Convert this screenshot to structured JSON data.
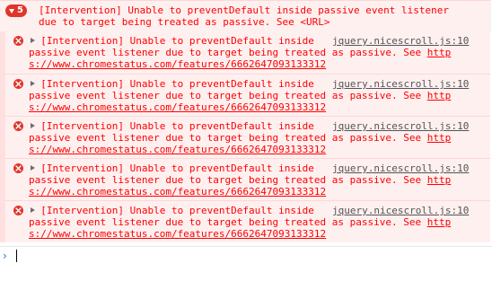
{
  "group": {
    "count": "5",
    "text_line1": "[Intervention] Unable to preventDefault inside passive event listener",
    "text_line2": "due to target being treated as passive. See <URL>"
  },
  "messages": [
    {
      "line1": "[Intervention] Unable to preventDefault inside",
      "line2": "passive event listener due to target being treated as passive. See ",
      "url_a": "http",
      "url_b": "s://www.chromestatus.com/features/6662647093133312",
      "source": "jquery.nicescroll.js:10"
    },
    {
      "line1": "[Intervention] Unable to preventDefault inside",
      "line2": "passive event listener due to target being treated as passive. See ",
      "url_a": "http",
      "url_b": "s://www.chromestatus.com/features/6662647093133312",
      "source": "jquery.nicescroll.js:10"
    },
    {
      "line1": "[Intervention] Unable to preventDefault inside",
      "line2": "passive event listener due to target being treated as passive. See ",
      "url_a": "http",
      "url_b": "s://www.chromestatus.com/features/6662647093133312",
      "source": "jquery.nicescroll.js:10"
    },
    {
      "line1": "[Intervention] Unable to preventDefault inside",
      "line2": "passive event listener due to target being treated as passive. See ",
      "url_a": "http",
      "url_b": "s://www.chromestatus.com/features/6662647093133312",
      "source": "jquery.nicescroll.js:10"
    },
    {
      "line1": "[Intervention] Unable to preventDefault inside",
      "line2": "passive event listener due to target being treated as passive. See ",
      "url_a": "http",
      "url_b": "s://www.chromestatus.com/features/6662647093133312",
      "source": "jquery.nicescroll.js:10"
    }
  ],
  "prompt": {
    "chevron": "›",
    "value": ""
  },
  "colors": {
    "error_text": "#fe0000",
    "error_bg": "#fff0f0",
    "error_icon": "#e0352b",
    "prompt_accent": "#1a73e8"
  },
  "icons": [
    "error-icon",
    "expand-triangle-icon",
    "prompt-chevron-icon",
    "badge-chevron-icon"
  ]
}
